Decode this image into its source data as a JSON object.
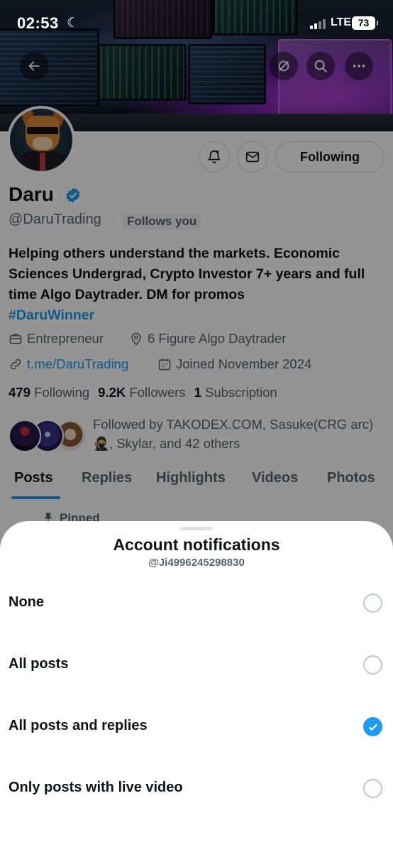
{
  "status_bar": {
    "time": "02:53",
    "network": "LTE",
    "battery": "73"
  },
  "profile": {
    "name": "Daru",
    "handle": "@DaruTrading",
    "follows_you": "Follows you",
    "following_button": "Following",
    "bio": "Helping others understand the markets. Economic Sciences Undergrad, Crypto Investor 7+ years and full time Algo Daytrader. DM for promos",
    "hashtag": "#DaruWinner",
    "category": "Entrepreneur",
    "location": "6 Figure Algo Daytrader",
    "website": "t.me/DaruTrading",
    "joined": "Joined November 2024",
    "stats": {
      "following_count": "479",
      "following_label": "Following",
      "followers_count": "9.2K",
      "followers_label": "Followers",
      "subscription_count": "1",
      "subscription_label": "Subscription"
    },
    "followed_by": "Followed by TAKODEX.COM, Sasuke(CRG arc)🥷, Skylar, and 42 others"
  },
  "tabs": [
    {
      "label": "Posts",
      "active": true
    },
    {
      "label": "Replies",
      "active": false
    },
    {
      "label": "Highlights",
      "active": false
    },
    {
      "label": "Videos",
      "active": false
    },
    {
      "label": "Photos",
      "active": false
    }
  ],
  "pinned_label": "Pinned",
  "sheet": {
    "title": "Account notifications",
    "subtitle": "@Ji4996245298830",
    "options": [
      {
        "label": "None",
        "selected": false
      },
      {
        "label": "All posts",
        "selected": false
      },
      {
        "label": "All posts and replies",
        "selected": true
      },
      {
        "label": "Only posts with live video",
        "selected": false
      }
    ]
  },
  "colors": {
    "accent": "#1d9bf0",
    "text": "#0f1419",
    "secondary": "#536471"
  },
  "icons": [
    "back-arrow-icon",
    "refresh-icon",
    "search-icon",
    "more-icon",
    "bell-add-icon",
    "mail-icon",
    "verified-badge-icon",
    "briefcase-icon",
    "location-pin-icon",
    "link-icon",
    "calendar-icon",
    "pin-icon",
    "check-icon"
  ]
}
